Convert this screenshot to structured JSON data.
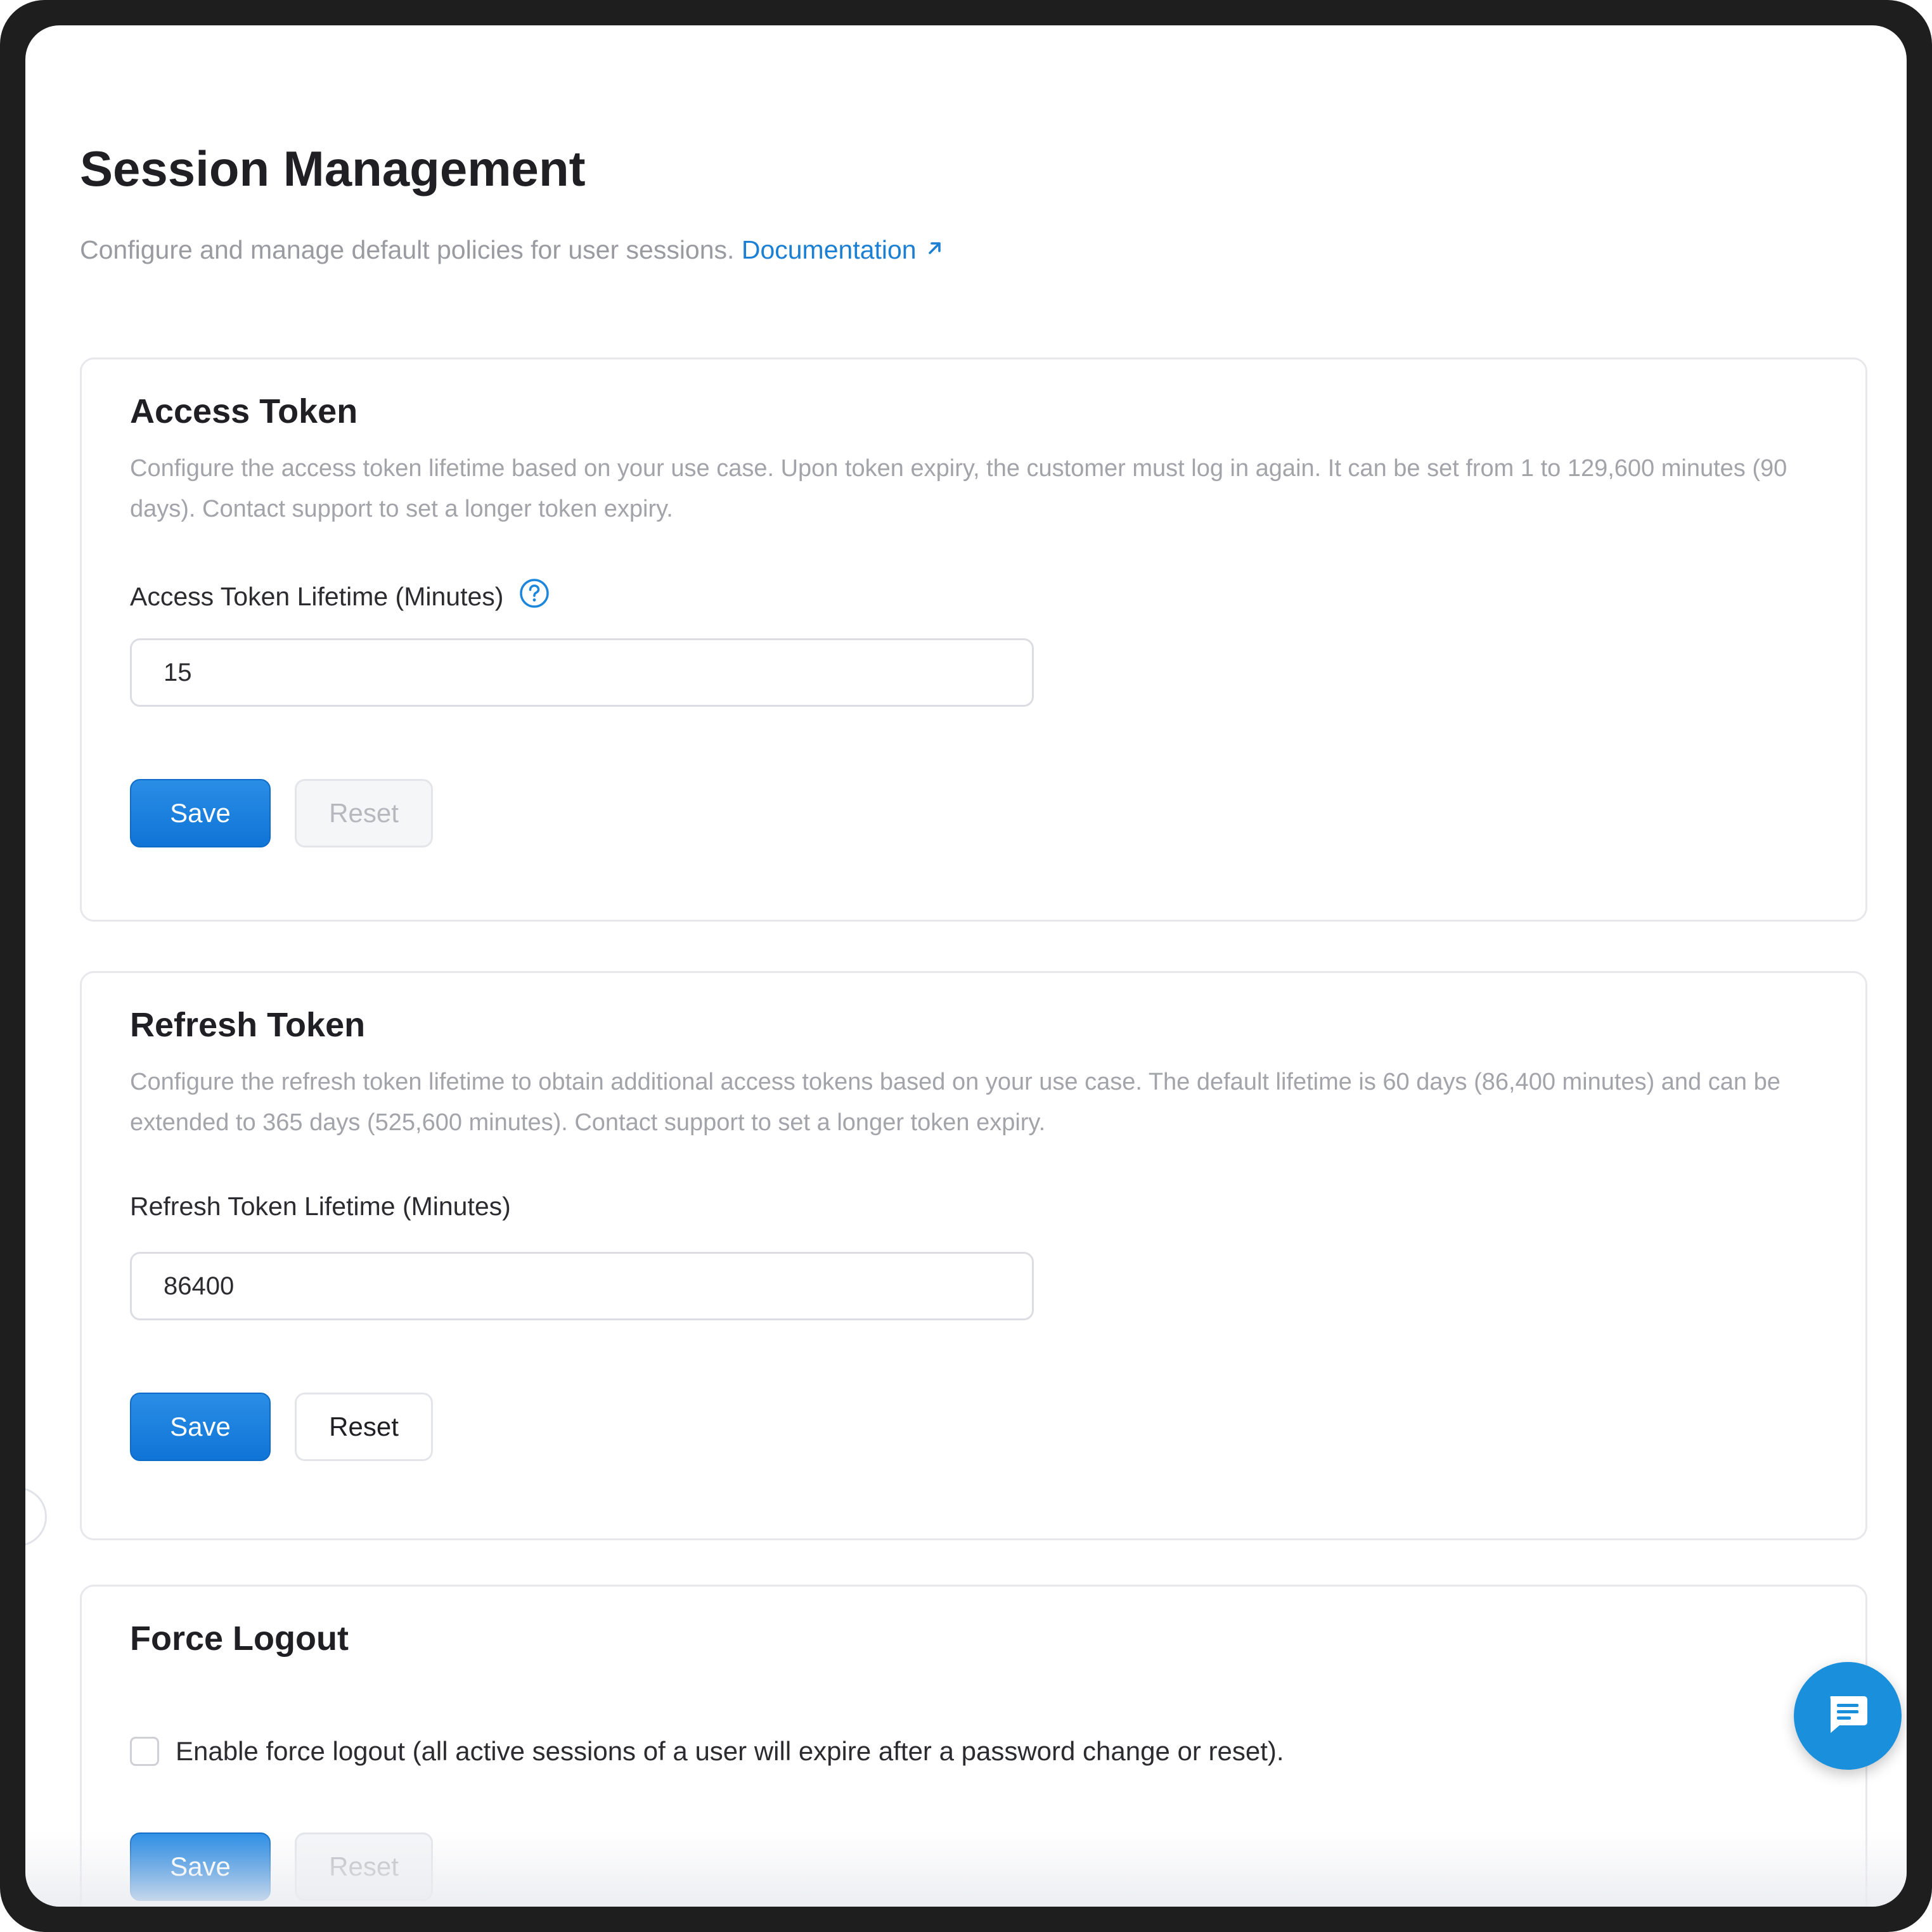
{
  "header": {
    "title": "Session Management",
    "subtitle": "Configure and manage default policies for user sessions.",
    "doc_link": "Documentation"
  },
  "access_token": {
    "title": "Access Token",
    "description": "Configure the access token lifetime based on your use case. Upon token expiry, the customer must log in again. It can be set from 1 to 129,600 minutes (90 days). Contact support to set a longer token expiry.",
    "field_label": "Access Token Lifetime (Minutes)",
    "field_value": "15",
    "save_label": "Save",
    "reset_label": "Reset",
    "reset_disabled": true
  },
  "refresh_token": {
    "title": "Refresh Token",
    "description": "Configure the refresh token lifetime to obtain additional access tokens based on your use case. The default lifetime is 60 days (86,400 minutes) and can be extended to 365 days (525,600 minutes). Contact support to set a longer token expiry.",
    "field_label": "Refresh Token Lifetime (Minutes)",
    "field_value": "86400",
    "save_label": "Save",
    "reset_label": "Reset",
    "reset_disabled": false
  },
  "force_logout": {
    "title": "Force Logout",
    "checkbox_label": "Enable force logout (all active sessions of a user will expire after a password change or reset).",
    "checked": false,
    "save_label": "Save",
    "reset_label": "Reset",
    "reset_disabled": true
  },
  "icons": {
    "external_link": "arrow-up-right-icon",
    "help": "question-circle-icon",
    "chat": "chat-bubble-icon"
  },
  "colors": {
    "primary": "#1178d9",
    "link": "#1b7fd4",
    "chat_fab": "#1a8fdc"
  }
}
